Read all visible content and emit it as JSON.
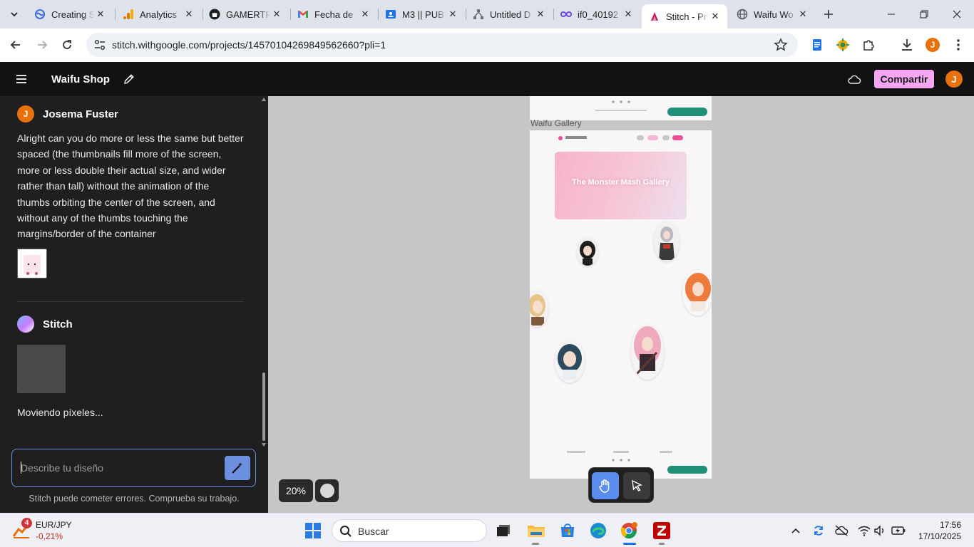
{
  "browser": {
    "tabs": [
      {
        "label": "Creating S",
        "icon": "stitch-creating-icon"
      },
      {
        "label": "Analytics",
        "icon": "analytics-icon"
      },
      {
        "label": "GAMERTR",
        "icon": "github-icon"
      },
      {
        "label": "Fecha de",
        "icon": "gmail-icon"
      },
      {
        "label": "M3 || PUB",
        "icon": "classroom-icon"
      },
      {
        "label": "Untitled D",
        "icon": "diagram-icon"
      },
      {
        "label": "if0_40192",
        "icon": "infinity-icon"
      },
      {
        "label": "Stitch - Pr",
        "icon": "stitch-icon"
      },
      {
        "label": "Waifu Wo",
        "icon": "globe-icon"
      }
    ],
    "active_tab": "Stitch - Pr",
    "url": "stitch.withgoogle.com/projects/14570104269849562660?pli=1",
    "profile_initial": "J"
  },
  "app": {
    "project_name": "Waifu Shop",
    "share_label": "Compartir",
    "user_initial": "J",
    "accent_color": "#f7a6f3"
  },
  "chat": {
    "user": {
      "initial": "J",
      "name": "Josema Fuster",
      "message": "Alright can you do more or less the same but better spaced (the thumbnails fill more of the screen, more or less double their actual size, and wider rather than tall) without the animation of the thumbs orbiting the center of the screen, and without any of the thumbs touching the margins/border of the container"
    },
    "assistant": {
      "name": "Stitch",
      "status": "Moviendo píxeles..."
    },
    "input_placeholder": "Describe tu diseño",
    "disclaimer": "Stitch puede cometer errores. Comprueba su trabajo."
  },
  "canvas": {
    "frame_label": "Waifu Gallery",
    "hero_title": "The Monster Mash Gallery",
    "zoom": "20%"
  },
  "taskbar": {
    "widget": {
      "badge": "4",
      "name": "EUR/JPY",
      "value": "-0,21%"
    },
    "search_label": "Buscar",
    "time": "17:56",
    "date": "17/10/2025"
  }
}
